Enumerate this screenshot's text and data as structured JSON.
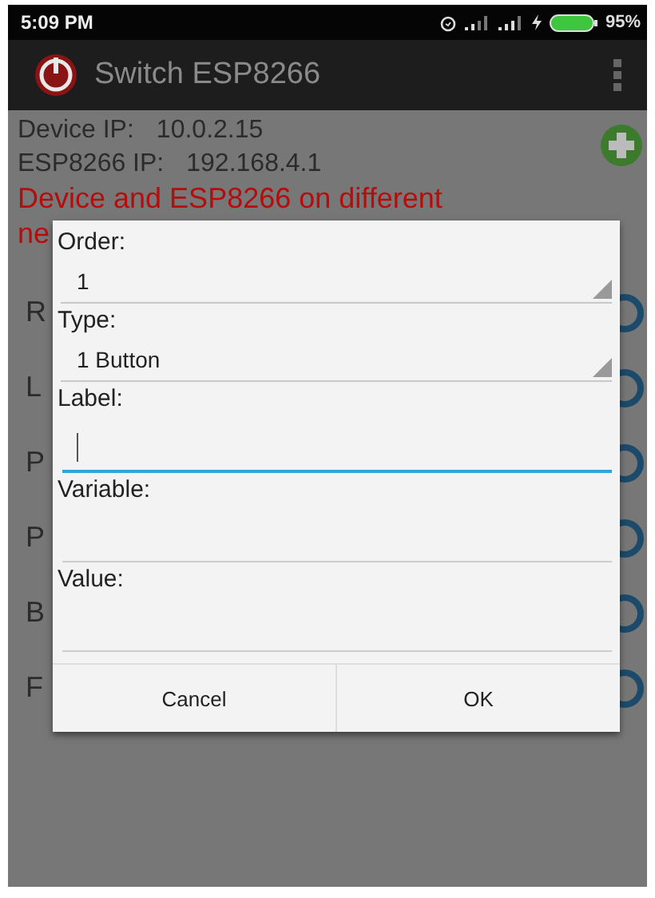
{
  "status_bar": {
    "time": "5:09 PM",
    "battery": "95%"
  },
  "app_bar": {
    "title": "Switch ESP8266"
  },
  "info": {
    "device_ip_label": "Device IP:",
    "device_ip": "10.0.2.15",
    "esp_ip_label": "ESP8266 IP:",
    "esp_ip": "192.168.4.1",
    "warning": [
      "Device and ESP8266 on different",
      "ne"
    ]
  },
  "rows": [
    {
      "label": "R"
    },
    {
      "label": "L"
    },
    {
      "label": "P"
    },
    {
      "label": "P"
    },
    {
      "label": "B"
    },
    {
      "label": "F"
    }
  ],
  "dialog": {
    "fields": [
      {
        "kind": "select",
        "label": "Order:",
        "value": "1"
      },
      {
        "kind": "select",
        "label": "Type:",
        "value": "1 Button"
      },
      {
        "kind": "input",
        "label": "Label:",
        "focused": true
      },
      {
        "kind": "input",
        "label": "Variable:",
        "focused": false
      },
      {
        "kind": "input",
        "label": "Value:",
        "focused": false
      }
    ],
    "buttons": [
      "Cancel",
      "OK"
    ]
  }
}
